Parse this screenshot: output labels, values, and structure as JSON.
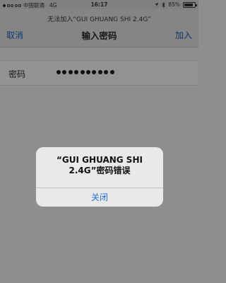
{
  "status_bar": {
    "carrier": "中国联通",
    "network": "4G",
    "time": "16:17",
    "bluetooth_icon": "bluetooth-icon",
    "battery_percent": "85%",
    "battery_level": 0.85
  },
  "nav": {
    "subtitle": "无法加入“GUI GHUANG SHI 2.4G”",
    "title": "输入密码",
    "cancel_label": "取消",
    "join_label": "加入"
  },
  "form": {
    "password_label": "密码",
    "password_length": 10
  },
  "alert": {
    "message": "“GUI GHUANG SHI 2.4G”密码错误",
    "button_label": "关闭"
  }
}
